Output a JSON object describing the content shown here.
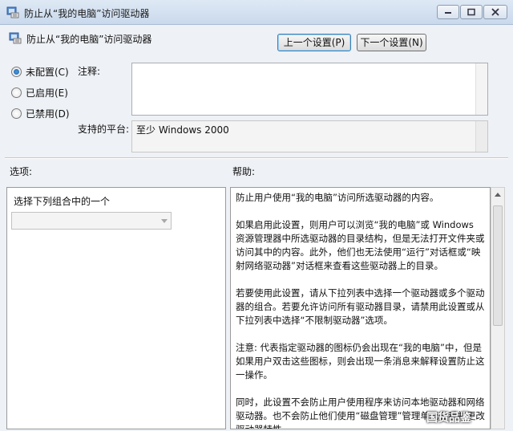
{
  "window": {
    "title": "防止从“我的电脑”访问驱动器",
    "controls": {
      "min_icon": "minimize-icon",
      "max_icon": "maximize-icon",
      "close_icon": "close-icon"
    }
  },
  "header": {
    "setting_name": "防止从“我的电脑”访问驱动器",
    "icon": "policy-setting-icon"
  },
  "nav": {
    "prev_label": "上一个设置(P)",
    "next_label": "下一个设置(N)"
  },
  "state": {
    "options": [
      {
        "label": "未配置(C)",
        "selected": true
      },
      {
        "label": "已启用(E)",
        "selected": false
      },
      {
        "label": "已禁用(D)",
        "selected": false
      }
    ]
  },
  "comment": {
    "label": "注释:",
    "value": ""
  },
  "platform": {
    "label": "支持的平台:",
    "value": "至少 Windows 2000"
  },
  "sections": {
    "options_label": "选项:",
    "help_label": "帮助:"
  },
  "options_panel": {
    "prompt": "选择下列组合中的一个",
    "combo_value": ""
  },
  "help": {
    "paragraphs": [
      "防止用户使用“我的电脑”访问所选驱动器的内容。",
      "如果启用此设置，则用户可以浏览“我的电脑”或 Windows 资源管理器中所选驱动器的目录结构，但是无法打开文件夹或访问其中的内容。此外，他们也无法使用“运行”对话框或“映射网络驱动器”对话框来查看这些驱动器上的目录。",
      "若要使用此设置，请从下拉列表中选择一个驱动器或多个驱动器的组合。若要允许访问所有驱动器目录，请禁用此设置或从下拉列表中选择“不限制驱动器”选项。",
      "注意: 代表指定驱动器的图标仍会出现在“我的电脑”中，但是如果用户双击这些图标，则会出现一条消息来解释设置防止这一操作。",
      "同时，此设置不会防止用户使用程序来访问本地驱动器和网络驱动器。也不会防止他们使用“磁盘管理”管理单元查看并更改驱动器特性。"
    ]
  },
  "watermark": "国货品鉴",
  "colors": {
    "accent": "#1c5fa8",
    "titlebar": "#c9d9ec"
  }
}
